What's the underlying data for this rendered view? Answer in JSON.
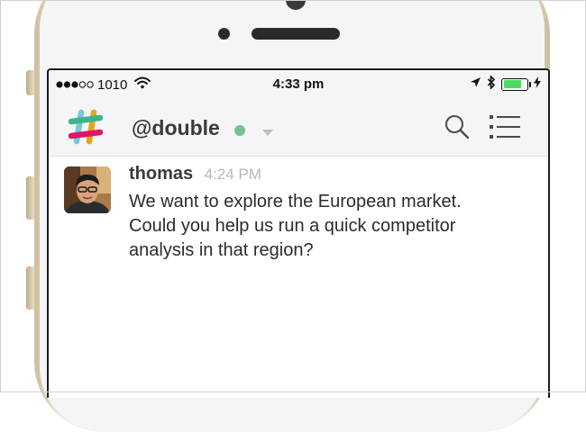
{
  "status_bar": {
    "carrier": "1010",
    "time": "4:33 pm",
    "battery_color": "#4cd964"
  },
  "header": {
    "channel": "@double",
    "presence_color": "#75c08f",
    "icons": [
      "slack-logo-icon",
      "chevron-down-icon",
      "search-icon",
      "menu-list-icon"
    ]
  },
  "message": {
    "author": "thomas",
    "time": "4:24 PM",
    "lines": [
      "We want to explore the European market.",
      "Could you help us run a quick competitor",
      "analysis in that region?"
    ]
  }
}
